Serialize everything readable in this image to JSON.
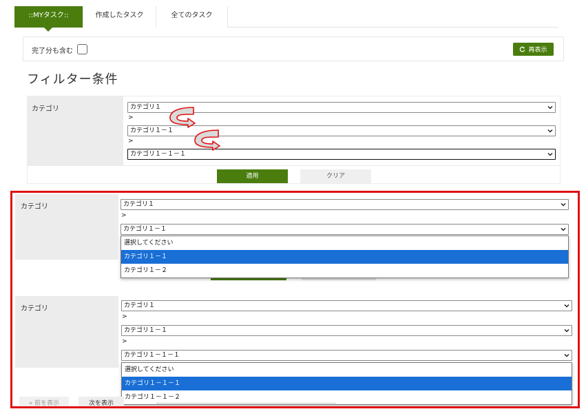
{
  "tabs": [
    {
      "label": "::MYタスク::"
    },
    {
      "label": "作成したタスク"
    },
    {
      "label": "全てのタスク"
    }
  ],
  "toolbar": {
    "include_done_label": "完了分も含む",
    "refresh_label": "再表示"
  },
  "heading": "フィルター条件",
  "filter": {
    "category_label": "カテゴリ",
    "level1_value": "カテゴリ１",
    "level2_value": "カテゴリ１－１",
    "level3_value": "カテゴリ１－１－１",
    "separator": ">",
    "apply_label": "適用",
    "clear_label": "クリア"
  },
  "panel_a": {
    "category_label": "カテゴリ",
    "level1_value": "カテゴリ１",
    "separator": ">",
    "level2_value": "カテゴリ１－１",
    "options": [
      "選択してください",
      "カテゴリ１－１",
      "カテゴリ１－２"
    ],
    "selected_index": 1
  },
  "panel_b": {
    "category_label": "カテゴリ",
    "level1_value": "カテゴリ１",
    "separator": ">",
    "level2_value": "カテゴリ１－１",
    "level3_value": "カテゴリ１－１－１",
    "options": [
      "選択してください",
      "カテゴリ１－１－１",
      "カテゴリ１－１－２"
    ],
    "selected_index": 1
  },
  "pager": {
    "prev_label": "« 前を表示",
    "next_label": "次を表示"
  },
  "colors": {
    "brand_green": "#4a7d0e",
    "highlight_red": "#e01010",
    "selected_blue": "#1a6fd6",
    "arrow_red": "#e01010"
  },
  "icons": {
    "refresh": "refresh-icon",
    "dropdown": "chevron-down-icon",
    "annotation_arrow": "curved-arrow-icon"
  }
}
